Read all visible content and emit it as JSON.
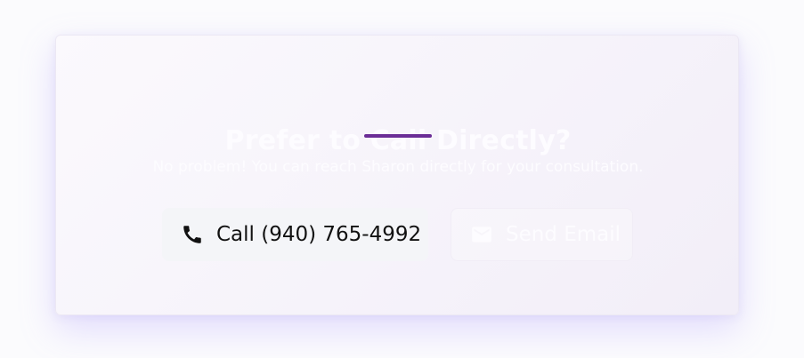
{
  "contact_card": {
    "title": "Prefer to Call Directly?",
    "subtitle": "No problem! You can reach Sharon directly for your consultation.",
    "accent_color": "#6b2d96",
    "call_button": {
      "icon": "phone-icon",
      "label": "Call (940) 765-4992"
    },
    "email_button": {
      "icon": "envelope-icon",
      "label": "Send Email"
    }
  }
}
